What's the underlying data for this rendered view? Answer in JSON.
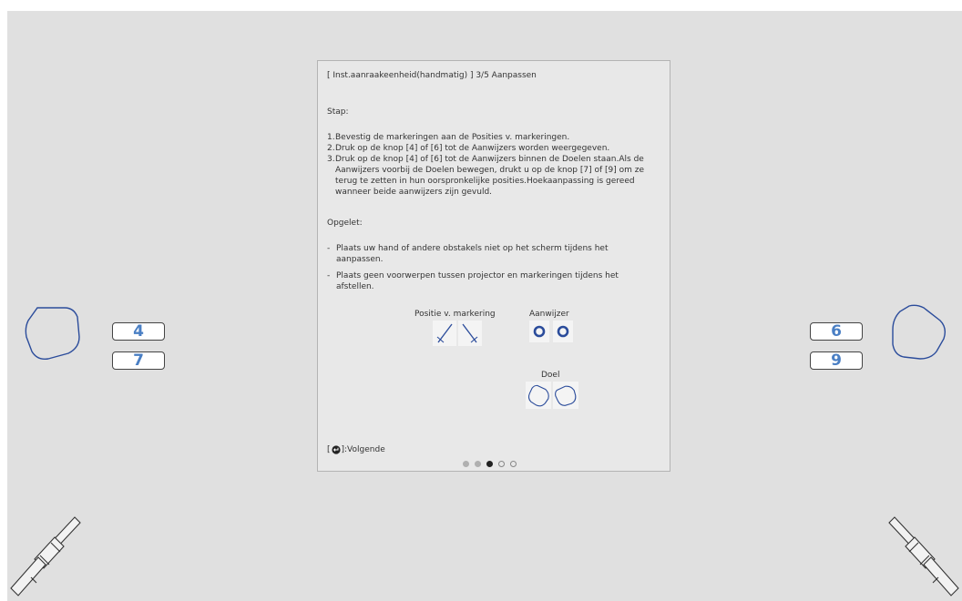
{
  "panel": {
    "title": "[ Inst.aanraakeenheid(handmatig) ]  3/5 Aanpassen",
    "stap_label": "Stap:",
    "steps": [
      {
        "num": "1.",
        "text": "Bevestig de markeringen aan de Posities v. markeringen."
      },
      {
        "num": "2.",
        "text": "Druk op de knop [4] of [6] tot de Aanwijzers worden weergegeven."
      },
      {
        "num": "3.",
        "text": "Druk op de knop [4] of [6] tot de Aanwijzers binnen de Doelen staan.Als de Aanwijzers voorbij de Doelen bewegen, drukt u op de knop [7] of [9] om ze terug te zetten in hun oorspronkelijke posities.Hoekaanpassing is gereed wanneer beide aanwijzers zijn gevuld."
      }
    ],
    "opgelet_label": "Opgelet:",
    "notes": [
      {
        "num": "-",
        "text": "Plaats uw hand of andere obstakels niet op het scherm tijdens het aanpassen."
      },
      {
        "num": "-",
        "text": "Plaats geen voorwerpen tussen projector en markeringen tijdens het afstellen."
      }
    ],
    "legend": {
      "marker_position": "Positie v. markering",
      "pointer": "Aanwijzer",
      "target": "Doel"
    },
    "footer": {
      "bracket_open": "[",
      "next_label": "]:Volgende",
      "icon": "enter-icon"
    },
    "pager": {
      "total": 5,
      "current": 3
    }
  },
  "keys": {
    "left_top": "4",
    "left_bottom": "7",
    "right_top": "6",
    "right_bottom": "9"
  },
  "colors": {
    "accent_blue": "#2b4c9b",
    "key_text": "#4a7fc4",
    "background": "#e0e0e0"
  }
}
